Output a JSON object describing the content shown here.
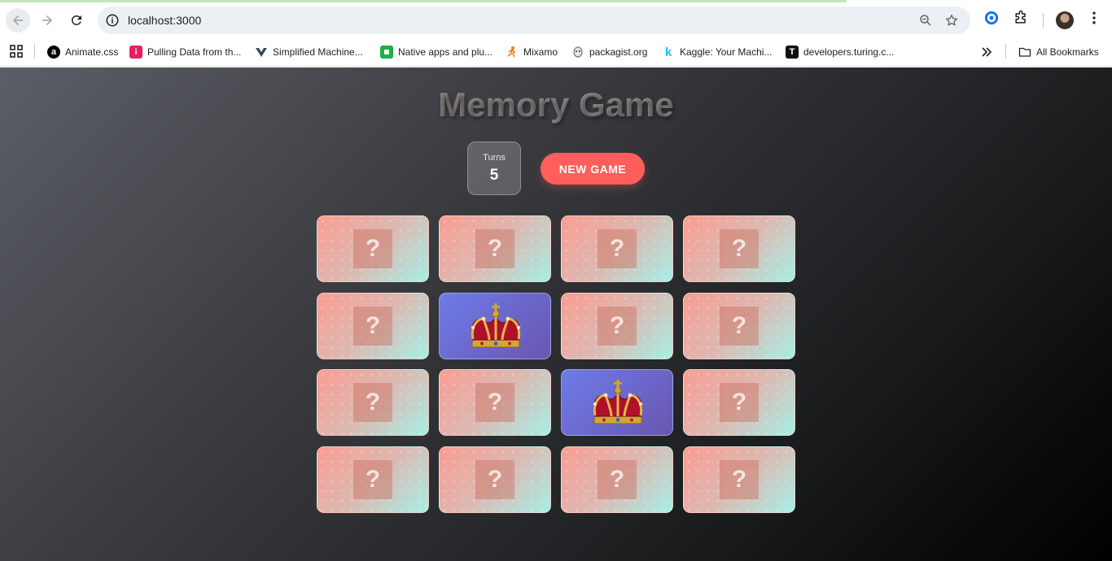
{
  "browser": {
    "url": "localhost:3000",
    "bookmarks": [
      {
        "label": "Animate.css",
        "icon": "animate-icon",
        "color": "#000000",
        "glyph": "a"
      },
      {
        "label": "Pulling Data from th...",
        "icon": "info-bookmark-icon",
        "color": "#e91e63",
        "glyph": "i"
      },
      {
        "label": "Simplified Machine...",
        "icon": "vue-icon",
        "color": "#ffffff",
        "glyph": ""
      },
      {
        "label": "Native apps and plu...",
        "icon": "plugin-icon",
        "color": "#1fae49",
        "glyph": ""
      },
      {
        "label": "Mixamo",
        "icon": "mixamo-icon",
        "color": "#ff7a00",
        "glyph": ""
      },
      {
        "label": "packagist.org",
        "icon": "packagist-icon",
        "color": "#ffffff",
        "glyph": ""
      },
      {
        "label": "Kaggle: Your Machi...",
        "icon": "kaggle-icon",
        "color": "#ffffff",
        "glyph": "k"
      },
      {
        "label": "developers.turing.c...",
        "icon": "turing-icon",
        "color": "#111111",
        "glyph": "T"
      }
    ],
    "all_bookmarks_label": "All Bookmarks"
  },
  "game": {
    "title": "Memory Game",
    "turns_label": "Turns",
    "turns_value": "5",
    "new_game_label": "NEW GAME",
    "hidden_card_symbol": "?",
    "cards": [
      {
        "state": "hidden"
      },
      {
        "state": "hidden"
      },
      {
        "state": "hidden"
      },
      {
        "state": "hidden"
      },
      {
        "state": "hidden"
      },
      {
        "state": "revealed",
        "image": "crown-icon"
      },
      {
        "state": "hidden"
      },
      {
        "state": "hidden"
      },
      {
        "state": "hidden"
      },
      {
        "state": "hidden"
      },
      {
        "state": "revealed",
        "image": "crown-icon"
      },
      {
        "state": "hidden"
      },
      {
        "state": "hidden"
      },
      {
        "state": "hidden"
      },
      {
        "state": "hidden"
      },
      {
        "state": "hidden"
      }
    ]
  },
  "colors": {
    "accent": "#ff5e5b",
    "revealed_card": "#6d7be8",
    "hidden_card_start": "#f99d92",
    "hidden_card_end": "#a6efe6"
  }
}
